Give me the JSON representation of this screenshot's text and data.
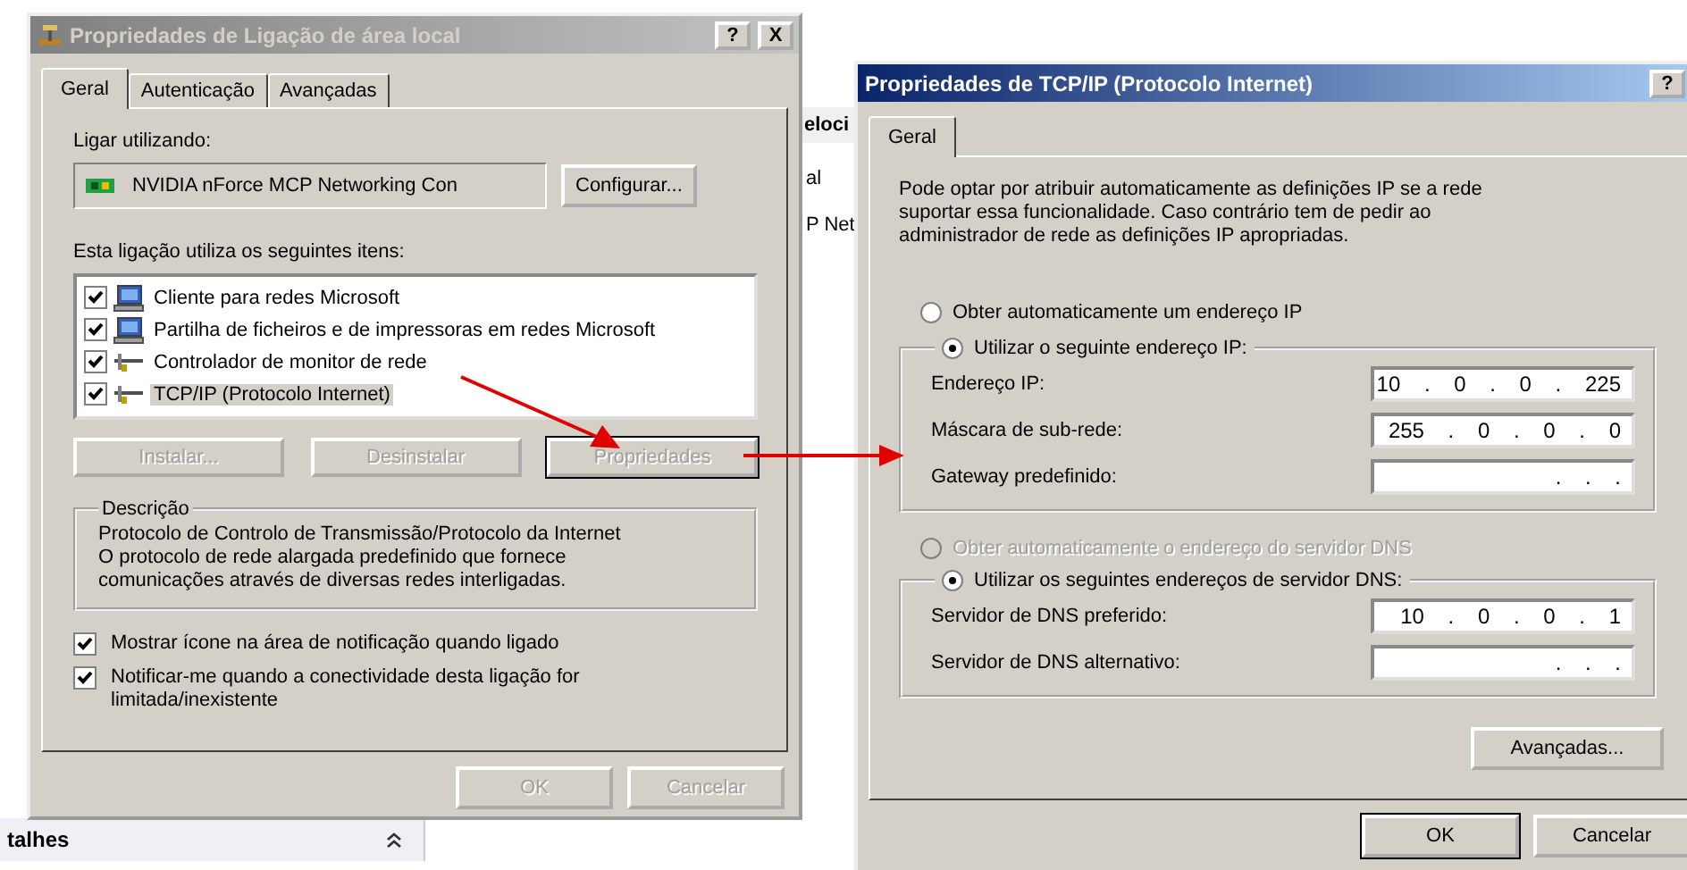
{
  "background_window": {
    "column_header": "eloci",
    "cells": [
      "al",
      "P Net"
    ],
    "details_header": "talhes"
  },
  "connection_dialog": {
    "title": "Propriedades de Ligação de área local",
    "active": false,
    "title_buttons": [
      "?",
      "X"
    ],
    "tabs": [
      {
        "label": "Geral",
        "selected": true
      },
      {
        "label": "Autenticação",
        "selected": false
      },
      {
        "label": "Avançadas",
        "selected": false
      }
    ],
    "connect_using_label": "Ligar utilizando:",
    "adapter": "NVIDIA nForce MCP Networking Con",
    "configure_button": "Configurar...",
    "items_label": "Esta ligação utiliza os seguintes itens:",
    "items": [
      {
        "label": "Cliente para redes Microsoft",
        "kind": "computer",
        "checked": true,
        "selected": false
      },
      {
        "label": "Partilha de ficheiros e de impressoras em redes Microsoft",
        "kind": "computer",
        "checked": true,
        "selected": false
      },
      {
        "label": "Controlador de monitor de rede",
        "kind": "protocol",
        "checked": true,
        "selected": false
      },
      {
        "label": "TCP/IP (Protocolo Internet)",
        "kind": "protocol",
        "checked": true,
        "selected": true
      }
    ],
    "item_buttons": [
      {
        "label": "Instalar...",
        "disabled": true,
        "default": false
      },
      {
        "label": "Desinstalar",
        "disabled": true,
        "default": false
      },
      {
        "label": "Propriedades",
        "disabled": true,
        "default": true
      }
    ],
    "description": {
      "title": "Descrição",
      "text": "Protocolo de Controlo de Transmissão/Protocolo da Internet\nO protocolo de rede alargada predefinido que fornece\ncomunicações através de diversas redes interligadas."
    },
    "options": [
      {
        "label": "Mostrar ícone na área de notificação quando ligado",
        "checked": true
      },
      {
        "label": "Notificar-me quando a conectividade desta ligação for\nlimitada/inexistente",
        "checked": true
      }
    ],
    "buttons": [
      {
        "label": "OK",
        "disabled": true,
        "default": false
      },
      {
        "label": "Cancelar",
        "disabled": true,
        "default": false
      }
    ]
  },
  "tcpip_dialog": {
    "title": "Propriedades de TCP/IP (Protocolo Internet)",
    "active": true,
    "title_buttons": [
      "?"
    ],
    "tabs": [
      {
        "label": "Geral",
        "selected": true
      }
    ],
    "intro": "Pode optar por atribuir automaticamente as definições IP se a rede\nsuportar essa funcionalidade. Caso contrário tem de pedir ao\nadministrador de rede as definições IP apropriadas.",
    "ip_auto": {
      "label": "Obter automaticamente um endereço IP",
      "selected": false,
      "disabled": false
    },
    "ip_manual": {
      "label": "Utilizar o seguinte endereço IP:",
      "selected": true,
      "disabled": false,
      "fields": [
        {
          "label": "Endereço IP:",
          "value": "10 . 0 . 0 . 225"
        },
        {
          "label": "Máscara de sub-rede:",
          "value": "255 . 0 . 0 . 0"
        },
        {
          "label": "Gateway predefinido:",
          "value": ". . ."
        }
      ]
    },
    "dns_auto": {
      "label": "Obter automaticamente o endereço do servidor DNS",
      "selected": false,
      "disabled": true
    },
    "dns_manual": {
      "label": "Utilizar os seguintes endereços de servidor DNS:",
      "selected": true,
      "disabled": false,
      "fields": [
        {
          "label": "Servidor de DNS preferido:",
          "value": "10 . 0 . 0 . 1"
        },
        {
          "label": "Servidor de DNS alternativo:",
          "value": ". . ."
        }
      ]
    },
    "advanced_button": "Avançadas...",
    "buttons": [
      {
        "label": "OK",
        "disabled": false,
        "default": true
      },
      {
        "label": "Cancelar",
        "disabled": false,
        "default": false
      }
    ]
  }
}
